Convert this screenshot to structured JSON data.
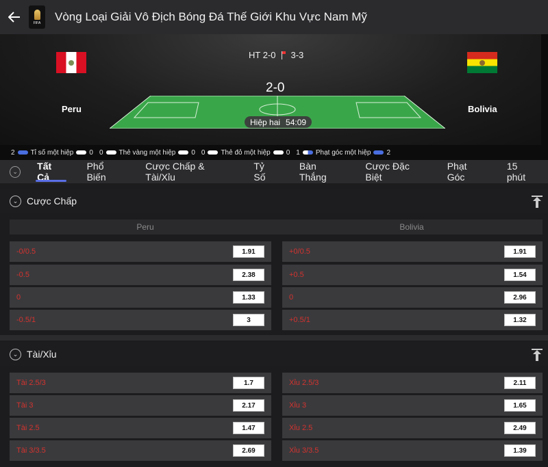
{
  "header": {
    "title": "Vòng Loại Giải Vô Địch Bóng Đá Thế Giới Khu Vực Nam Mỹ",
    "logo_text": "FIFA"
  },
  "match": {
    "home": "Peru",
    "away": "Bolivia",
    "halftime": "HT 2-0",
    "corners": "3-3",
    "score": "2-0",
    "period": "Hiệp hai",
    "clock": "54:09"
  },
  "stats": [
    {
      "home": "2",
      "label": "Tỉ số một hiệp",
      "away": "0"
    },
    {
      "home": "0",
      "label": "Thẻ vàng một hiệp",
      "away": "0"
    },
    {
      "home": "0",
      "label": "Thẻ đỏ một hiệp",
      "away": "0"
    },
    {
      "home": "1",
      "label": "Phạt góc một hiệp",
      "away": "2"
    }
  ],
  "tabs": [
    "Tất Cả",
    "Phổ Biến",
    "Cược Chấp & Tài/Xỉu",
    "Tỷ Số",
    "Bàn Thắng",
    "Cược Đặc Biệt",
    "Phạt Góc",
    "15 phút"
  ],
  "handicap": {
    "title": "Cược Chấp",
    "home_col": "Peru",
    "away_col": "Bolivia",
    "rows": [
      {
        "home_label": "-0/0.5",
        "home_odd": "1.91",
        "away_label": "+0/0.5",
        "away_odd": "1.91"
      },
      {
        "home_label": "-0.5",
        "home_odd": "2.38",
        "away_label": "+0.5",
        "away_odd": "1.54"
      },
      {
        "home_label": "0",
        "home_odd": "1.33",
        "away_label": "0",
        "away_odd": "2.96"
      },
      {
        "home_label": "-0.5/1",
        "home_odd": "3",
        "away_label": "+0.5/1",
        "away_odd": "1.32"
      }
    ]
  },
  "totals": {
    "title": "Tài/Xỉu",
    "rows": [
      {
        "over_label": "Tài 2.5/3",
        "over_odd": "1.7",
        "under_label": "Xỉu 2.5/3",
        "under_odd": "2.11"
      },
      {
        "over_label": "Tài 3",
        "over_odd": "2.17",
        "under_label": "Xỉu 3",
        "under_odd": "1.65"
      },
      {
        "over_label": "Tài 2.5",
        "over_odd": "1.47",
        "under_label": "Xỉu 2.5",
        "under_odd": "2.49"
      },
      {
        "over_label": "Tài 3/3.5",
        "over_odd": "2.69",
        "under_label": "Xỉu 3/3.5",
        "under_odd": "1.39"
      }
    ]
  }
}
